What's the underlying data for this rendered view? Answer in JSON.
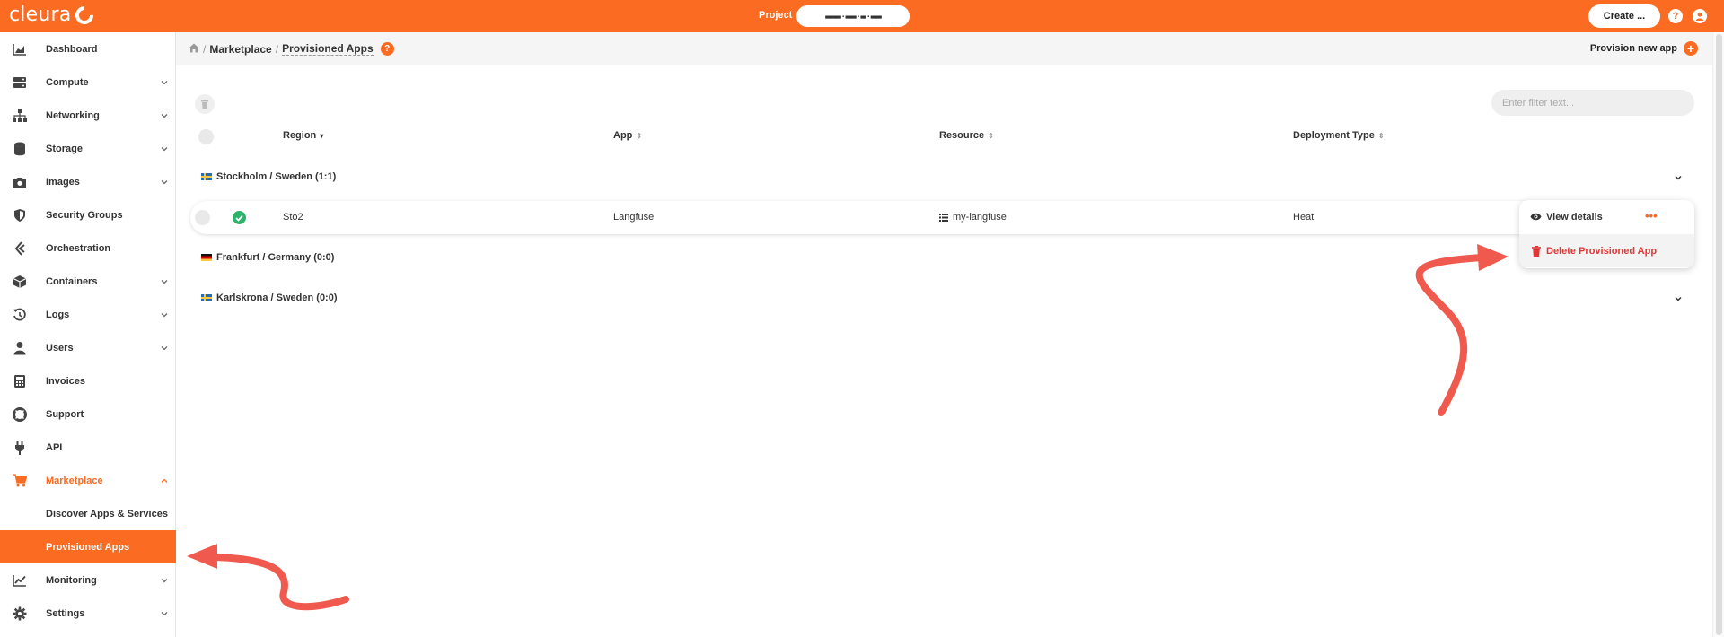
{
  "topbar": {
    "logo_text": "cleura",
    "project_label": "Project",
    "project_value": "▬▬▬·▬▬·▬·▬▬",
    "create_label": "Create ...",
    "help_glyph": "?",
    "user_glyph": "●"
  },
  "sidebar": {
    "items": [
      {
        "label": "Dashboard",
        "icon": "chart-area-icon"
      },
      {
        "label": "Compute",
        "icon": "server-icon"
      },
      {
        "label": "Networking",
        "icon": "sitemap-icon"
      },
      {
        "label": "Storage",
        "icon": "database-icon"
      },
      {
        "label": "Images",
        "icon": "camera-icon"
      },
      {
        "label": "Security Groups",
        "icon": "shield-icon"
      },
      {
        "label": "Orchestration",
        "icon": "orchestration-icon"
      },
      {
        "label": "Containers",
        "icon": "cube-icon"
      },
      {
        "label": "Logs",
        "icon": "history-icon"
      },
      {
        "label": "Users",
        "icon": "user-icon"
      },
      {
        "label": "Invoices",
        "icon": "calculator-icon"
      },
      {
        "label": "Support",
        "icon": "lifebuoy-icon"
      },
      {
        "label": "API",
        "icon": "plug-icon"
      },
      {
        "label": "Marketplace",
        "icon": "cart-icon"
      },
      {
        "label": "Discover Apps & Services"
      },
      {
        "label": "Provisioned Apps"
      },
      {
        "label": "Monitoring",
        "icon": "chart-line-icon"
      },
      {
        "label": "Settings",
        "icon": "gear-icon"
      }
    ]
  },
  "breadcrumb": {
    "home_icon": "home-icon",
    "marketplace": "Marketplace",
    "current": "Provisioned Apps",
    "separator": "/",
    "help_glyph": "?"
  },
  "actions": {
    "provision_new": "Provision new app",
    "plus_glyph": "+"
  },
  "filter": {
    "placeholder": "Enter filter text..."
  },
  "table": {
    "columns": [
      "Region",
      "App",
      "Resource",
      "Deployment Type"
    ],
    "sort_active": "▾",
    "sort_inactive": "⇕",
    "groups": [
      {
        "label": "Stockholm / Sweden",
        "count": "(1:1)"
      },
      {
        "label": "Frankfurt / Germany",
        "count": "(0:0)"
      },
      {
        "label": "Karlskrona / Sweden",
        "count": "(0:0)"
      }
    ],
    "row": {
      "region": "Sto2",
      "app": "Langfuse",
      "resource": "my-langfuse",
      "deployment_type": "Heat",
      "more_glyph": "•••"
    }
  },
  "row_menu": {
    "view_details": "View details",
    "delete": "Delete Provisioned App"
  },
  "colors": {
    "brand": "#fb6b22",
    "danger": "#e13636",
    "success": "#2db26a",
    "annotation_arrow": "#f05a4e"
  }
}
